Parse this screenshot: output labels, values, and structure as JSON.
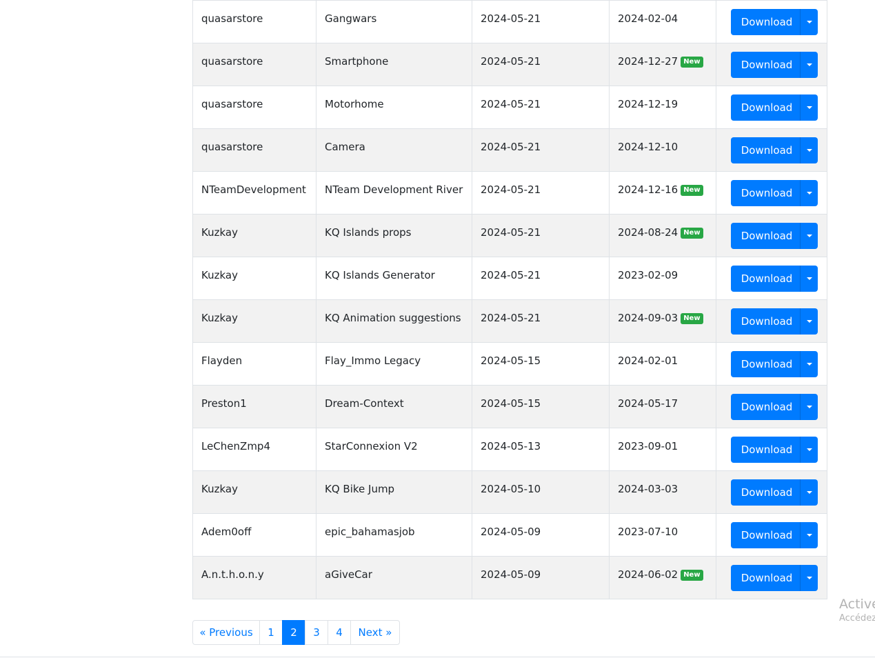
{
  "rows": [
    {
      "author": "quasarstore",
      "name": "Gangwars",
      "added": "2024-05-21",
      "updated": "2024-02-04",
      "badge": "",
      "download": "Download"
    },
    {
      "author": "quasarstore",
      "name": "Smartphone",
      "added": "2024-05-21",
      "updated": "2024-12-27",
      "badge": "New",
      "download": "Download"
    },
    {
      "author": "quasarstore",
      "name": "Motorhome",
      "added": "2024-05-21",
      "updated": "2024-12-19",
      "badge": "",
      "download": "Download"
    },
    {
      "author": "quasarstore",
      "name": "Camera",
      "added": "2024-05-21",
      "updated": "2024-12-10",
      "badge": "",
      "download": "Download"
    },
    {
      "author": "NTeamDevelopment",
      "name": "NTeam Development River",
      "added": "2024-05-21",
      "updated": "2024-12-16",
      "badge": "New",
      "download": "Download"
    },
    {
      "author": "Kuzkay",
      "name": "KQ Islands props",
      "added": "2024-05-21",
      "updated": "2024-08-24",
      "badge": "New",
      "download": "Download"
    },
    {
      "author": "Kuzkay",
      "name": "KQ Islands Generator",
      "added": "2024-05-21",
      "updated": "2023-02-09",
      "badge": "",
      "download": "Download"
    },
    {
      "author": "Kuzkay",
      "name": "KQ Animation suggestions",
      "added": "2024-05-21",
      "updated": "2024-09-03",
      "badge": "New",
      "download": "Download"
    },
    {
      "author": "Flayden",
      "name": "Flay_Immo Legacy",
      "added": "2024-05-15",
      "updated": "2024-02-01",
      "badge": "",
      "download": "Download"
    },
    {
      "author": "Preston1",
      "name": "Dream-Context",
      "added": "2024-05-15",
      "updated": "2024-05-17",
      "badge": "",
      "download": "Download"
    },
    {
      "author": "LeChenZmp4",
      "name": "StarConnexion V2",
      "added": "2024-05-13",
      "updated": "2023-09-01",
      "badge": "",
      "download": "Download"
    },
    {
      "author": "Kuzkay",
      "name": "KQ Bike Jump",
      "added": "2024-05-10",
      "updated": "2024-03-03",
      "badge": "",
      "download": "Download"
    },
    {
      "author": "Adem0off",
      "name": "epic_bahamasjob",
      "added": "2024-05-09",
      "updated": "2023-07-10",
      "badge": "",
      "download": "Download"
    },
    {
      "author": "A.n.t.h.o.n.y",
      "name": "aGiveCar",
      "added": "2024-05-09",
      "updated": "2024-06-02",
      "badge": "New",
      "download": "Download"
    }
  ],
  "pagination": {
    "previous": "« Previous",
    "pages": [
      "1",
      "2",
      "3",
      "4"
    ],
    "current": "2",
    "next": "Next »"
  },
  "watermark": {
    "line1": "Active",
    "line2": "Accédez"
  },
  "colors": {
    "primary": "#007bff",
    "badge_new": "#28a745",
    "row_stripe": "#f2f2f2"
  }
}
